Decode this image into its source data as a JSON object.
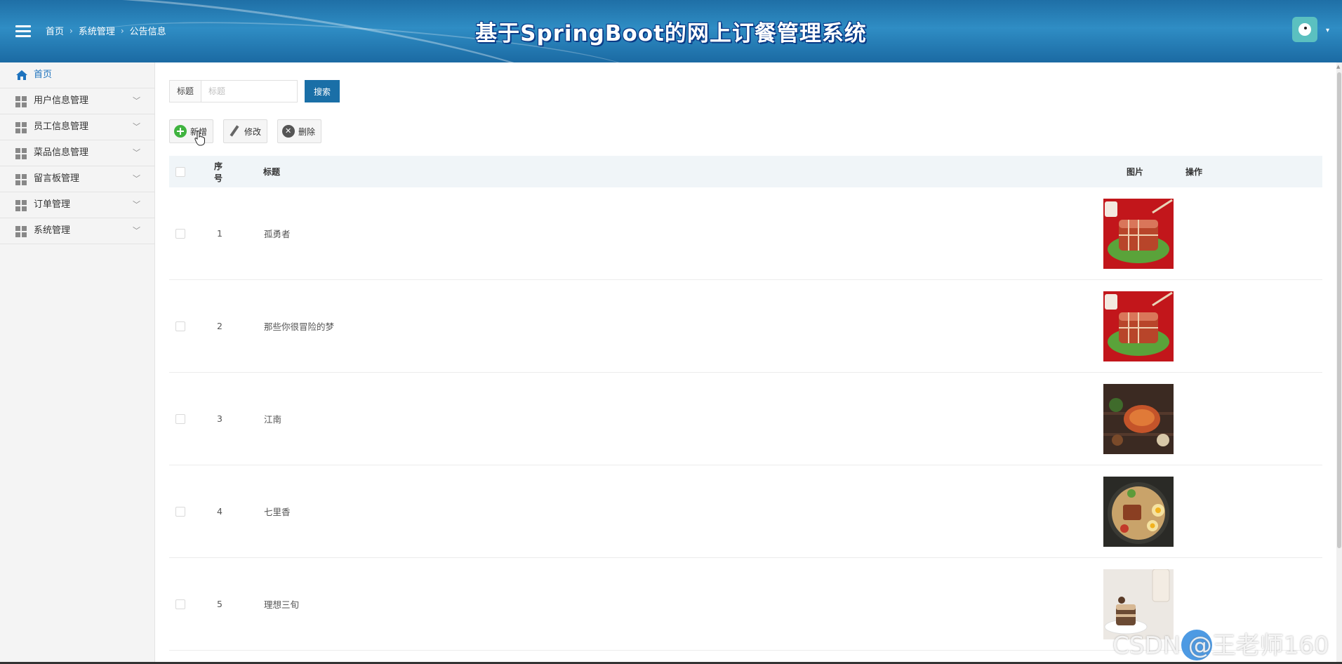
{
  "header": {
    "breadcrumb": [
      "首页",
      "系统管理",
      "公告信息"
    ],
    "title": "基于SpringBoot的网上订餐管理系统"
  },
  "sidebar": {
    "items": [
      {
        "label": "首页",
        "icon": "home-icon",
        "active": true
      },
      {
        "label": "用户信息管理",
        "icon": "grid-icon"
      },
      {
        "label": "员工信息管理",
        "icon": "grid-icon"
      },
      {
        "label": "菜品信息管理",
        "icon": "grid-icon"
      },
      {
        "label": "留言板管理",
        "icon": "grid-icon"
      },
      {
        "label": "订单管理",
        "icon": "grid-icon"
      },
      {
        "label": "系统管理",
        "icon": "grid-icon"
      }
    ]
  },
  "search": {
    "label": "标题",
    "placeholder": "标题",
    "button": "搜索"
  },
  "toolbar": {
    "add": "新增",
    "edit": "修改",
    "delete": "删除"
  },
  "table": {
    "columns": {
      "index": "序号",
      "title": "标题",
      "image": "图片",
      "action": "操作"
    },
    "rows": [
      {
        "index": "1",
        "title": "孤勇者",
        "image": "braised-pork-dish"
      },
      {
        "index": "2",
        "title": "那些你很冒险的梦",
        "image": "braised-pork-dish"
      },
      {
        "index": "3",
        "title": "江南",
        "image": "grilled-food-on-wood"
      },
      {
        "index": "4",
        "title": "七里香",
        "image": "noodle-bowl-with-eggs"
      },
      {
        "index": "5",
        "title": "理想三旬",
        "image": "dessert-and-drink"
      }
    ]
  },
  "watermark": "CSDN @王老师160",
  "colors": {
    "header": "#2180bb",
    "accent": "#1a6fa7",
    "active_nav": "#1e73be"
  }
}
